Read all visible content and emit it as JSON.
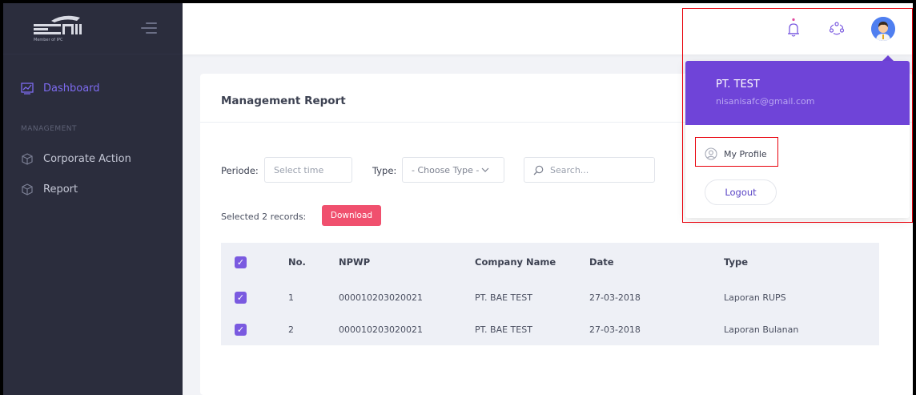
{
  "brand": {
    "logo_text": "EDII",
    "logo_subtext": "Member of IPC"
  },
  "sidebar": {
    "items": [
      {
        "label": "Dashboard",
        "active": true
      },
      {
        "label": "Corporate Action"
      },
      {
        "label": "Report"
      }
    ],
    "section_label": "MANAGEMENT"
  },
  "card": {
    "title": "Management Report",
    "filters": {
      "periode_label": "Periode:",
      "periode_placeholder": "Select time",
      "type_label": "Type:",
      "type_placeholder": "- Choose Type -",
      "search_placeholder": "Search..."
    },
    "selected_text": "Selected 2 records:",
    "download_label": "Download"
  },
  "table": {
    "headers": [
      "No.",
      "NPWP",
      "Company Name",
      "Date",
      "Type"
    ],
    "rows": [
      {
        "no": "1",
        "npwp": "000010203020021",
        "company": "PT. BAE TEST",
        "date": "27-03-2018",
        "type": "Laporan RUPS",
        "checked": true
      },
      {
        "no": "2",
        "npwp": "000010203020021",
        "company": "PT. BAE TEST",
        "date": "27-03-2018",
        "type": "Laporan Bulanan",
        "checked": true
      }
    ],
    "header_checked": true
  },
  "profile_menu": {
    "name": "PT. TEST",
    "email": "nisanisafc@gmail.com",
    "my_profile_label": "My Profile",
    "logout_label": "Logout"
  },
  "colors": {
    "sidebar_bg": "#2b2d3d",
    "accent": "#6f44d8",
    "download": "#f0506e",
    "annotation": "#e8000b"
  }
}
